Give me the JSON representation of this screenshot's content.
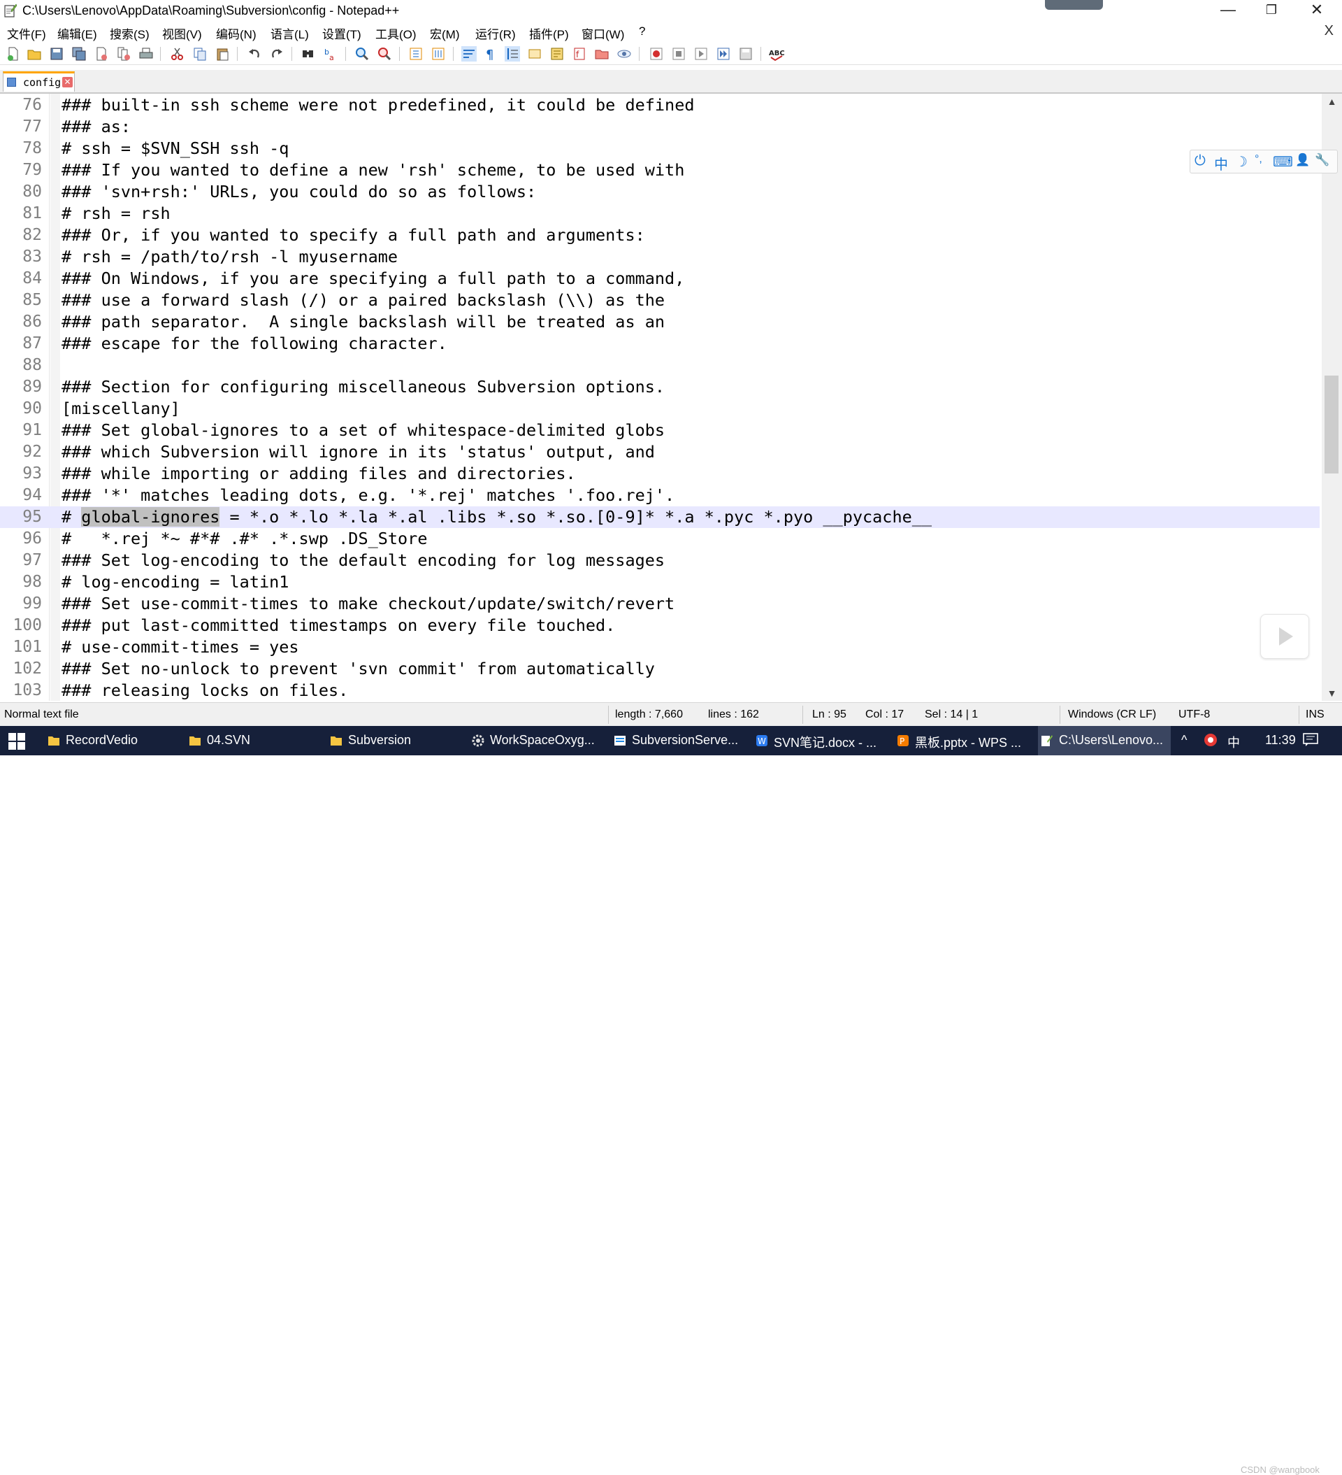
{
  "window": {
    "title": "C:\\Users\\Lenovo\\AppData\\Roaming\\Subversion\\config - Notepad++",
    "controls": {
      "minimize": "—",
      "restore": "❐",
      "close": "✕"
    }
  },
  "menu": {
    "items": [
      "文件(F)",
      "编辑(E)",
      "搜索(S)",
      "视图(V)",
      "编码(N)",
      "语言(L)",
      "设置(T)",
      "工具(O)",
      "宏(M)",
      "运行(R)",
      "插件(P)",
      "窗口(W)",
      "?"
    ],
    "close_doc": "X"
  },
  "tabs": [
    {
      "label": "config"
    }
  ],
  "editor": {
    "lines": [
      {
        "n": "76",
        "text": "### built-in ssh scheme were not predefined, it could be defined"
      },
      {
        "n": "77",
        "text": "### as:"
      },
      {
        "n": "78",
        "text": "# ssh = $SVN_SSH ssh -q"
      },
      {
        "n": "79",
        "text": "### If you wanted to define a new 'rsh' scheme, to be used with"
      },
      {
        "n": "80",
        "text": "### 'svn+rsh:' URLs, you could do so as follows:"
      },
      {
        "n": "81",
        "text": "# rsh = rsh"
      },
      {
        "n": "82",
        "text": "### Or, if you wanted to specify a full path and arguments:"
      },
      {
        "n": "83",
        "text": "# rsh = /path/to/rsh -l myusername"
      },
      {
        "n": "84",
        "text": "### On Windows, if you are specifying a full path to a command,"
      },
      {
        "n": "85",
        "text": "### use a forward slash (/) or a paired backslash (\\\\) as the"
      },
      {
        "n": "86",
        "text": "### path separator.  A single backslash will be treated as an"
      },
      {
        "n": "87",
        "text": "### escape for the following character."
      },
      {
        "n": "88",
        "text": ""
      },
      {
        "n": "89",
        "text": "### Section for configuring miscellaneous Subversion options."
      },
      {
        "n": "90",
        "text": "[miscellany]"
      },
      {
        "n": "91",
        "text": "### Set global-ignores to a set of whitespace-delimited globs"
      },
      {
        "n": "92",
        "text": "### which Subversion will ignore in its 'status' output, and"
      },
      {
        "n": "93",
        "text": "### while importing or adding files and directories."
      },
      {
        "n": "94",
        "text": "### '*' matches leading dots, e.g. '*.rej' matches '.foo.rej'."
      },
      {
        "n": "95",
        "pre": "# ",
        "sel": "global-ignores",
        "post": " = *.o *.lo *.la *.al .libs *.so *.so.[0-9]* *.a *.pyc *.pyo __pycache__"
      },
      {
        "n": "96",
        "text": "#   *.rej *~ #*# .#* .*.swp .DS_Store"
      },
      {
        "n": "97",
        "text": "### Set log-encoding to the default encoding for log messages"
      },
      {
        "n": "98",
        "text": "# log-encoding = latin1"
      },
      {
        "n": "99",
        "text": "### Set use-commit-times to make checkout/update/switch/revert"
      },
      {
        "n": "100",
        "text": "### put last-committed timestamps on every file touched."
      },
      {
        "n": "101",
        "text": "# use-commit-times = yes"
      },
      {
        "n": "102",
        "text": "### Set no-unlock to prevent 'svn commit' from automatically"
      },
      {
        "n": "103",
        "text": "### releasing locks on files."
      }
    ]
  },
  "ime": {
    "items": [
      "⏻",
      "中",
      "☽",
      "°,",
      "⌨",
      "👤",
      "🔧"
    ]
  },
  "status": {
    "file_type": "Normal text file",
    "length": "length : 7,660",
    "lines": "lines : 162",
    "ln": "Ln : 95",
    "col": "Col : 17",
    "sel": "Sel : 14 | 1",
    "eol": "Windows (CR LF)",
    "encoding": "UTF-8",
    "mode": "INS"
  },
  "taskbar": {
    "items": [
      {
        "label": "RecordVedio"
      },
      {
        "label": "04.SVN"
      },
      {
        "label": "Subversion"
      },
      {
        "label": "WorkSpaceOxyg..."
      },
      {
        "label": "SubversionServe..."
      },
      {
        "label": "SVN笔记.docx - ..."
      },
      {
        "label": "黑板.pptx - WPS ..."
      },
      {
        "label": "C:\\Users\\Lenovo..."
      }
    ],
    "tray": {
      "caret": "^",
      "ime": "中",
      "time": "11:39"
    }
  },
  "watermark": "CSDN @wangbook",
  "colors": {
    "tab_accent": "#ffa500",
    "current_line": "#e8e8ff",
    "selection": "#c0c0c0",
    "taskbar": "#16203a"
  }
}
